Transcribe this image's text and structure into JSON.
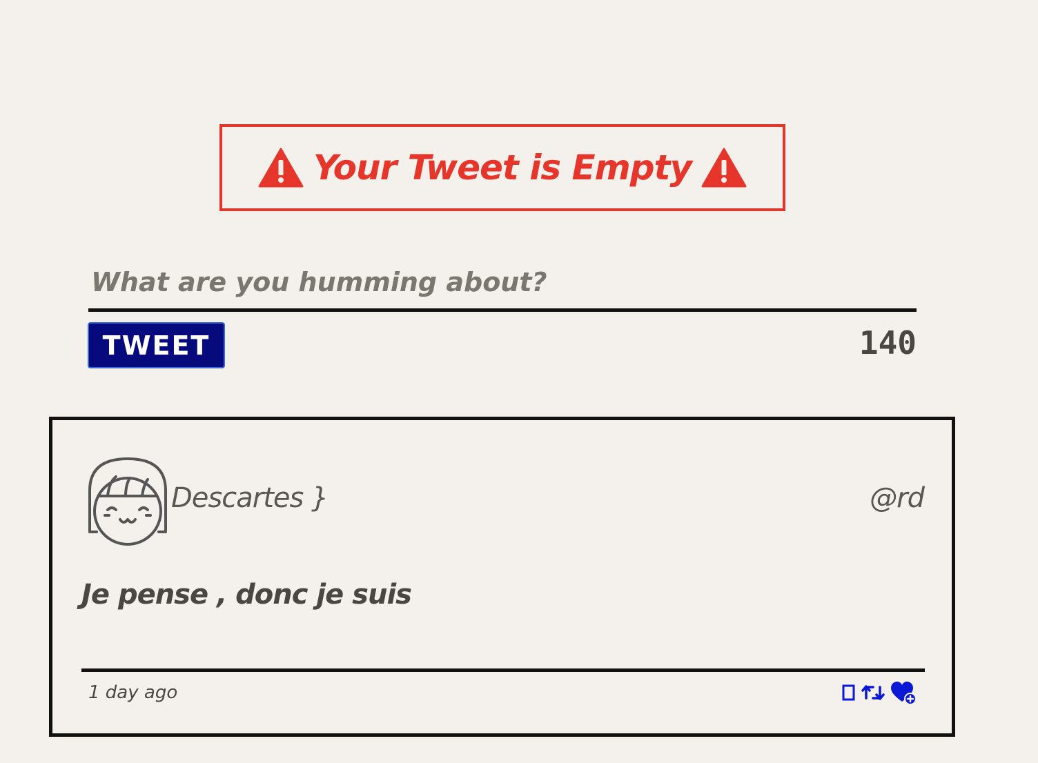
{
  "error_banner": {
    "message": "Your Tweet is Empty",
    "color": "#e6352b",
    "icon": "warning-triangle-icon"
  },
  "composer": {
    "placeholder": "What are you humming about?",
    "value": "",
    "tweet_button_label": "TWEET",
    "char_counter": "140"
  },
  "tweet": {
    "author_name": "Descartes }",
    "handle": "@rd",
    "body": "Je pense , donc je suis",
    "timestamp": "1 day ago",
    "avatar_icon": "smiling-girl-avatar-icon",
    "actions": [
      "flag-icon",
      "retweet-icon",
      "like-icon"
    ],
    "action_color": "#0b18d6"
  },
  "colors": {
    "background": "#f4f1ec",
    "button": "#060a7c",
    "text": "#4a4742"
  }
}
